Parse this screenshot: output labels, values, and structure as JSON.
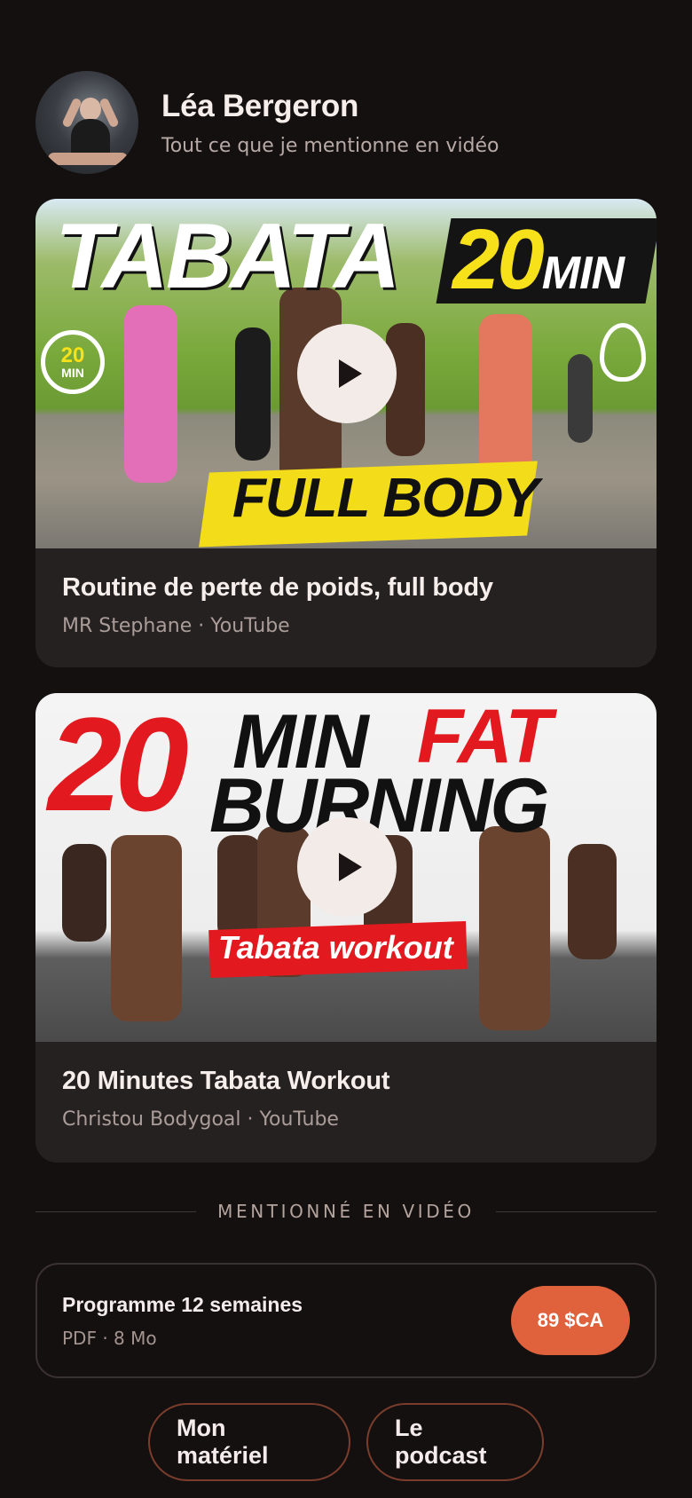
{
  "profile": {
    "name": "Léa Bergeron",
    "subtitle": "Tout ce que je mentionne en vidéo"
  },
  "videos": [
    {
      "title": "Routine de perte de poids, full body",
      "meta": "MR Stephane · YouTube",
      "thumbnail_text": {
        "headline": "TABATA",
        "duration_number": "20",
        "duration_unit": "MIN",
        "banner": "FULL BODY",
        "timer_number": "20",
        "timer_unit": "MIN"
      }
    },
    {
      "title": "20 Minutes Tabata Workout",
      "meta": "Christou Bodygoal · YouTube",
      "thumbnail_text": {
        "number": "20",
        "min": "MIN",
        "fat": "FAT",
        "burning": "BURNING",
        "banner": "Tabata workout"
      }
    }
  ],
  "section_label": "MENTIONNÉ EN VIDÉO",
  "product": {
    "title": "Programme 12 semaines",
    "meta": "PDF · 8 Mo",
    "price": "89 $CA"
  },
  "links": [
    {
      "label": "Mon matériel"
    },
    {
      "label": "Le podcast"
    }
  ],
  "colors": {
    "background": "#151010",
    "card": "#262121",
    "accent": "#e0623d"
  },
  "icons": {
    "play": "play-icon"
  }
}
